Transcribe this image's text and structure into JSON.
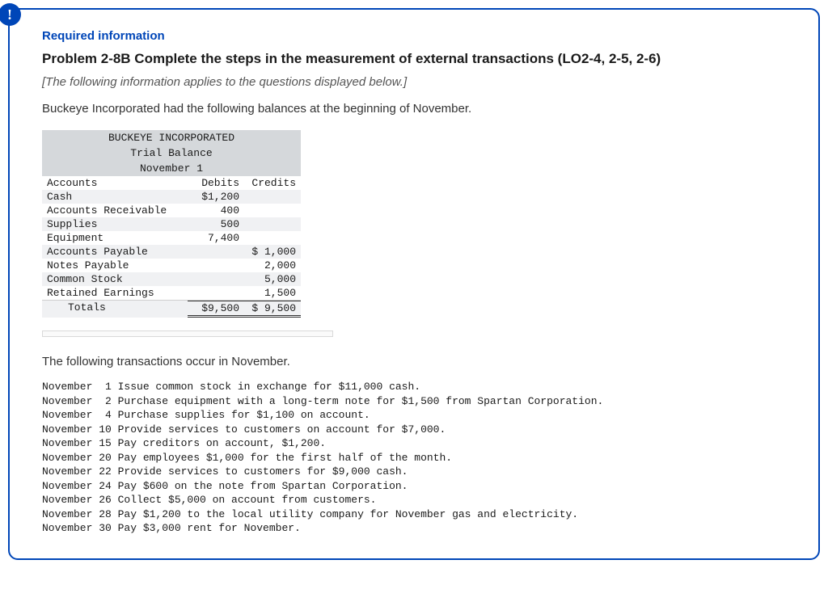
{
  "header": {
    "alert_icon_glyph": "!",
    "required_label": "Required information",
    "problem_title": "Problem 2-8B Complete the steps in the measurement of external transactions (LO2-4, 2-5, 2-6)",
    "italic_note": "[The following information applies to the questions displayed below.]",
    "intro": "Buckeye Incorporated had the following balances at the beginning of November."
  },
  "trial_balance": {
    "company": "BUCKEYE INCORPORATED",
    "title": "Trial Balance",
    "date": "November 1",
    "col_accounts": "Accounts",
    "col_debits": "Debits",
    "col_credits": "Credits",
    "rows": [
      {
        "account": "Cash",
        "debit": "$1,200",
        "credit": ""
      },
      {
        "account": "Accounts Receivable",
        "debit": "400",
        "credit": ""
      },
      {
        "account": "Supplies",
        "debit": "500",
        "credit": ""
      },
      {
        "account": "Equipment",
        "debit": "7,400",
        "credit": ""
      },
      {
        "account": "Accounts Payable",
        "debit": "",
        "credit": "$ 1,000"
      },
      {
        "account": "Notes Payable",
        "debit": "",
        "credit": "2,000"
      },
      {
        "account": "Common Stock",
        "debit": "",
        "credit": "5,000"
      },
      {
        "account": "Retained Earnings",
        "debit": "",
        "credit": "1,500"
      }
    ],
    "totals_label": "Totals",
    "totals_debit": "$9,500",
    "totals_credit": "$ 9,500"
  },
  "transactions_intro": "The following transactions occur in November.",
  "transactions": [
    {
      "date": "November  1",
      "desc": "Issue common stock in exchange for $11,000 cash."
    },
    {
      "date": "November  2",
      "desc": "Purchase equipment with a long-term note for $1,500 from Spartan Corporation."
    },
    {
      "date": "November  4",
      "desc": "Purchase supplies for $1,100 on account."
    },
    {
      "date": "November 10",
      "desc": "Provide services to customers on account for $7,000."
    },
    {
      "date": "November 15",
      "desc": "Pay creditors on account, $1,200."
    },
    {
      "date": "November 20",
      "desc": "Pay employees $1,000 for the first half of the month."
    },
    {
      "date": "November 22",
      "desc": "Provide services to customers for $9,000 cash."
    },
    {
      "date": "November 24",
      "desc": "Pay $600 on the note from Spartan Corporation."
    },
    {
      "date": "November 26",
      "desc": "Collect $5,000 on account from customers."
    },
    {
      "date": "November 28",
      "desc": "Pay $1,200 to the local utility company for November gas and electricity."
    },
    {
      "date": "November 30",
      "desc": "Pay $3,000 rent for November."
    }
  ]
}
